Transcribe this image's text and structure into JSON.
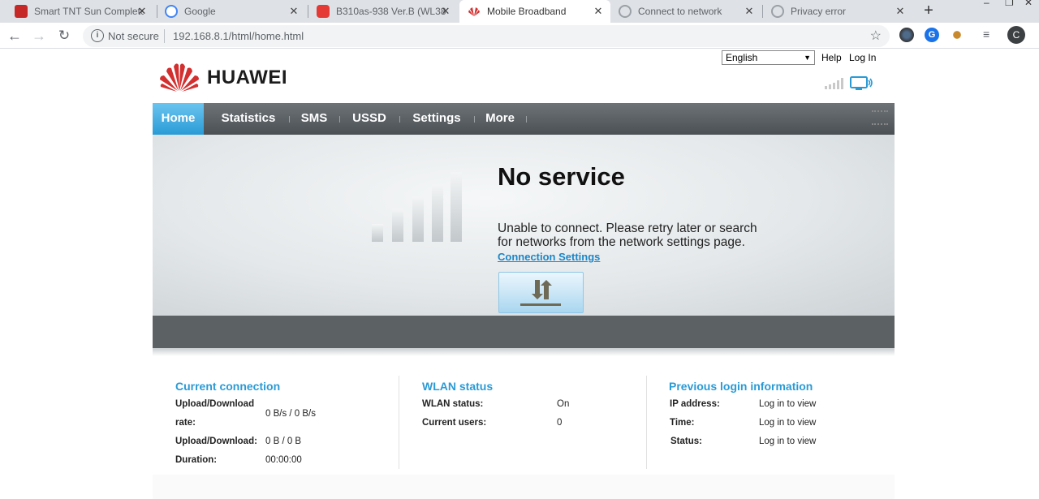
{
  "browser": {
    "tabs": [
      {
        "title": "Smart TNT Sun Complete",
        "icon": "smart-favicon",
        "color": "#c62828"
      },
      {
        "title": "Google",
        "icon": "google-favicon",
        "color": "#4285f4"
      },
      {
        "title": "B310as-938 Ver.B (WL38",
        "icon": "youtube-favicon",
        "color": "#e53935"
      },
      {
        "title": "Mobile Broadband",
        "icon": "huawei-favicon",
        "color": "#d32f2f",
        "active": true
      },
      {
        "title": "Connect to network",
        "icon": "globe-favicon",
        "color": "#9aa0a6"
      },
      {
        "title": "Privacy error",
        "icon": "globe-favicon",
        "color": "#9aa0a6"
      }
    ],
    "new_tab": "+",
    "omnibox": {
      "security_label": "Not secure",
      "url": "192.168.8.1/html/home.html"
    },
    "profile_initial": "C"
  },
  "header": {
    "brand": "HUAWEI",
    "language": "English",
    "help": "Help",
    "login": "Log In"
  },
  "menu": {
    "items": [
      "Home",
      "Statistics",
      "SMS",
      "USSD",
      "Settings",
      "More"
    ],
    "active": "Home"
  },
  "hero": {
    "title": "No service",
    "message": "Unable to connect. Please retry later or search for networks from the network settings page.",
    "link": "Connection Settings"
  },
  "panels": {
    "current_connection": {
      "title": "Current connection",
      "rate_label_1": "Upload/Download",
      "rate_label_2": "rate:",
      "rate_value": "0 B/s / 0 B/s",
      "volume_label": "Upload/Download:",
      "volume_value": "0 B / 0 B",
      "duration_label": "Duration:",
      "duration_value": "00:00:00"
    },
    "wlan": {
      "title": "WLAN status",
      "status_label": "WLAN status:",
      "status_value": "On",
      "users_label": "Current users:",
      "users_value": "0"
    },
    "login_info": {
      "title": "Previous login information",
      "ip_label": "IP address:",
      "ip_value": "Log in to view",
      "time_label": "Time:",
      "time_value": "Log in to view",
      "status_label": "Status:",
      "status_value": "Log in to view"
    }
  },
  "colors": {
    "accent": "#2a9ad5",
    "menu_active": "#3aa8e0",
    "brand_red": "#d32f2f"
  }
}
